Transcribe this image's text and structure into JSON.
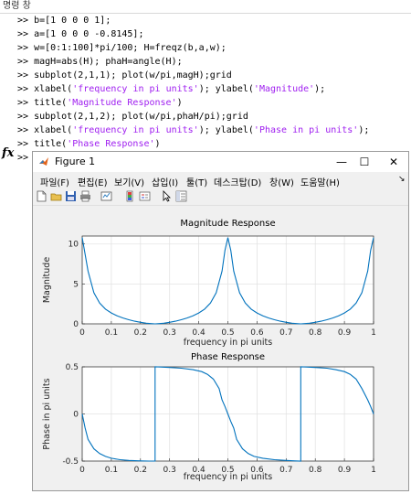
{
  "command_window": {
    "title": "명령 창",
    "prompt": ">>",
    "lines": [
      [
        {
          "t": "b=[1 0 0 0 1];",
          "s": false
        }
      ],
      [
        {
          "t": "a=[1 0 0 0 -0.8145];",
          "s": false
        }
      ],
      [
        {
          "t": "w=[0:1:100]*pi/100; H=freqz(b,a,w);",
          "s": false
        }
      ],
      [
        {
          "t": "magH=abs(H); phaH=angle(H);",
          "s": false
        }
      ],
      [
        {
          "t": "subplot(2,1,1); plot(w/pi,magH);grid",
          "s": false
        }
      ],
      [
        {
          "t": "xlabel(",
          "s": false
        },
        {
          "t": "'frequency in pi units'",
          "s": true
        },
        {
          "t": "); ylabel(",
          "s": false
        },
        {
          "t": "'Magnitude'",
          "s": true
        },
        {
          "t": ");",
          "s": false
        }
      ],
      [
        {
          "t": "title(",
          "s": false
        },
        {
          "t": "'Magnitude Response'",
          "s": true
        },
        {
          "t": ")",
          "s": false
        }
      ],
      [
        {
          "t": "subplot(2,1,2); plot(w/pi,phaH/pi);grid",
          "s": false
        }
      ],
      [
        {
          "t": "xlabel(",
          "s": false
        },
        {
          "t": "'frequency in pi units'",
          "s": true
        },
        {
          "t": "); ylabel(",
          "s": false
        },
        {
          "t": "'Phase in pi units'",
          "s": true
        },
        {
          "t": ");",
          "s": false
        }
      ],
      [
        {
          "t": "title(",
          "s": false
        },
        {
          "t": "'Phase Response'",
          "s": true
        },
        {
          "t": ")",
          "s": false
        }
      ]
    ],
    "fx_symbol": "fx"
  },
  "figure": {
    "title": "Figure 1",
    "buttons": {
      "minimize": "—",
      "maximize": "☐",
      "close": "✕"
    },
    "menu": [
      "파일(F)",
      "편집(E)",
      "보기(V)",
      "삽입(I)",
      "툴(T)",
      "데스크탑(D)",
      "창(W)",
      "도움말(H)"
    ],
    "menu_arrow": "↘",
    "toolbar_icons": [
      "new-figure-icon",
      "open-file-icon",
      "save-icon",
      "print-icon",
      "link-plot-icon",
      "insert-colorbar-icon",
      "insert-legend-icon",
      "pointer-icon",
      "property-editor-icon"
    ]
  },
  "chart_data": [
    {
      "type": "line",
      "title": "Magnitude Response",
      "xlabel": "frequency in pi units",
      "ylabel": "Magnitude",
      "xlim": [
        0,
        1
      ],
      "ylim": [
        0,
        11
      ],
      "xticks": [
        "0",
        "0.1",
        "0.2",
        "0.3",
        "0.4",
        "0.5",
        "0.6",
        "0.7",
        "0.8",
        "0.9",
        "1"
      ],
      "yticks": [
        "0",
        "5",
        "10"
      ],
      "ytick_values": [
        0,
        5,
        10
      ],
      "grid": true,
      "color": "#0072bd",
      "series": [
        {
          "x": [
            0,
            0.02,
            0.04,
            0.06,
            0.08,
            0.1,
            0.12,
            0.14,
            0.16,
            0.18,
            0.2,
            0.22,
            0.24,
            0.25,
            0.26,
            0.28,
            0.3,
            0.32,
            0.34,
            0.36,
            0.38,
            0.4,
            0.42,
            0.44,
            0.46,
            0.48,
            0.49,
            0.5,
            0.51,
            0.52,
            0.54,
            0.56,
            0.58,
            0.6,
            0.62,
            0.64,
            0.66,
            0.68,
            0.7,
            0.72,
            0.74,
            0.75,
            0.76,
            0.78,
            0.8,
            0.82,
            0.84,
            0.86,
            0.88,
            0.9,
            0.92,
            0.94,
            0.96,
            0.98,
            0.99,
            1
          ],
          "y": [
            10.8,
            6.6,
            3.9,
            2.6,
            1.85,
            1.36,
            1.0,
            0.73,
            0.51,
            0.33,
            0.19,
            0.08,
            0.02,
            0,
            0.02,
            0.08,
            0.19,
            0.33,
            0.51,
            0.73,
            1.0,
            1.36,
            1.85,
            2.6,
            3.9,
            6.6,
            9.2,
            10.8,
            9.2,
            6.6,
            3.9,
            2.6,
            1.85,
            1.36,
            1.0,
            0.73,
            0.51,
            0.33,
            0.19,
            0.08,
            0.02,
            0,
            0.02,
            0.08,
            0.19,
            0.33,
            0.51,
            0.73,
            1.0,
            1.36,
            1.85,
            2.6,
            3.9,
            6.6,
            9.2,
            10.8
          ]
        }
      ]
    },
    {
      "type": "line",
      "title": "Phase Response",
      "xlabel": "frequency in pi units",
      "ylabel": "Phase in pi units",
      "xlim": [
        0,
        1
      ],
      "ylim": [
        -0.5,
        0.5
      ],
      "xticks": [
        "0",
        "0.1",
        "0.2",
        "0.3",
        "0.4",
        "0.5",
        "0.6",
        "0.7",
        "0.8",
        "0.9",
        "1"
      ],
      "yticks": [
        "-0.5",
        "0",
        "0.5"
      ],
      "ytick_values": [
        -0.5,
        0,
        0.5
      ],
      "grid": true,
      "color": "#0072bd",
      "series": [
        {
          "x": [
            0,
            0.01,
            0.02,
            0.04,
            0.06,
            0.08,
            0.1,
            0.13,
            0.16,
            0.2,
            0.23,
            0.25,
            0.25,
            0.27,
            0.3,
            0.34,
            0.38,
            0.41,
            0.43,
            0.45,
            0.47,
            0.48,
            0.49,
            0.5,
            0.51,
            0.52,
            0.53,
            0.55,
            0.57,
            0.59,
            0.62,
            0.66,
            0.7,
            0.73,
            0.75,
            0.75,
            0.77,
            0.8,
            0.84,
            0.87,
            0.9,
            0.92,
            0.94,
            0.96,
            0.98,
            0.99,
            1
          ],
          "y": [
            0,
            -0.15,
            -0.27,
            -0.37,
            -0.42,
            -0.45,
            -0.47,
            -0.485,
            -0.493,
            -0.498,
            -0.5,
            -0.5,
            0.5,
            0.498,
            0.493,
            0.485,
            0.47,
            0.45,
            0.42,
            0.37,
            0.27,
            0.15,
            0.08,
            0,
            -0.08,
            -0.15,
            -0.27,
            -0.37,
            -0.42,
            -0.45,
            -0.47,
            -0.485,
            -0.493,
            -0.498,
            -0.5,
            0.5,
            0.498,
            0.493,
            0.485,
            0.47,
            0.45,
            0.42,
            0.37,
            0.27,
            0.15,
            0.08,
            0
          ]
        }
      ]
    }
  ]
}
